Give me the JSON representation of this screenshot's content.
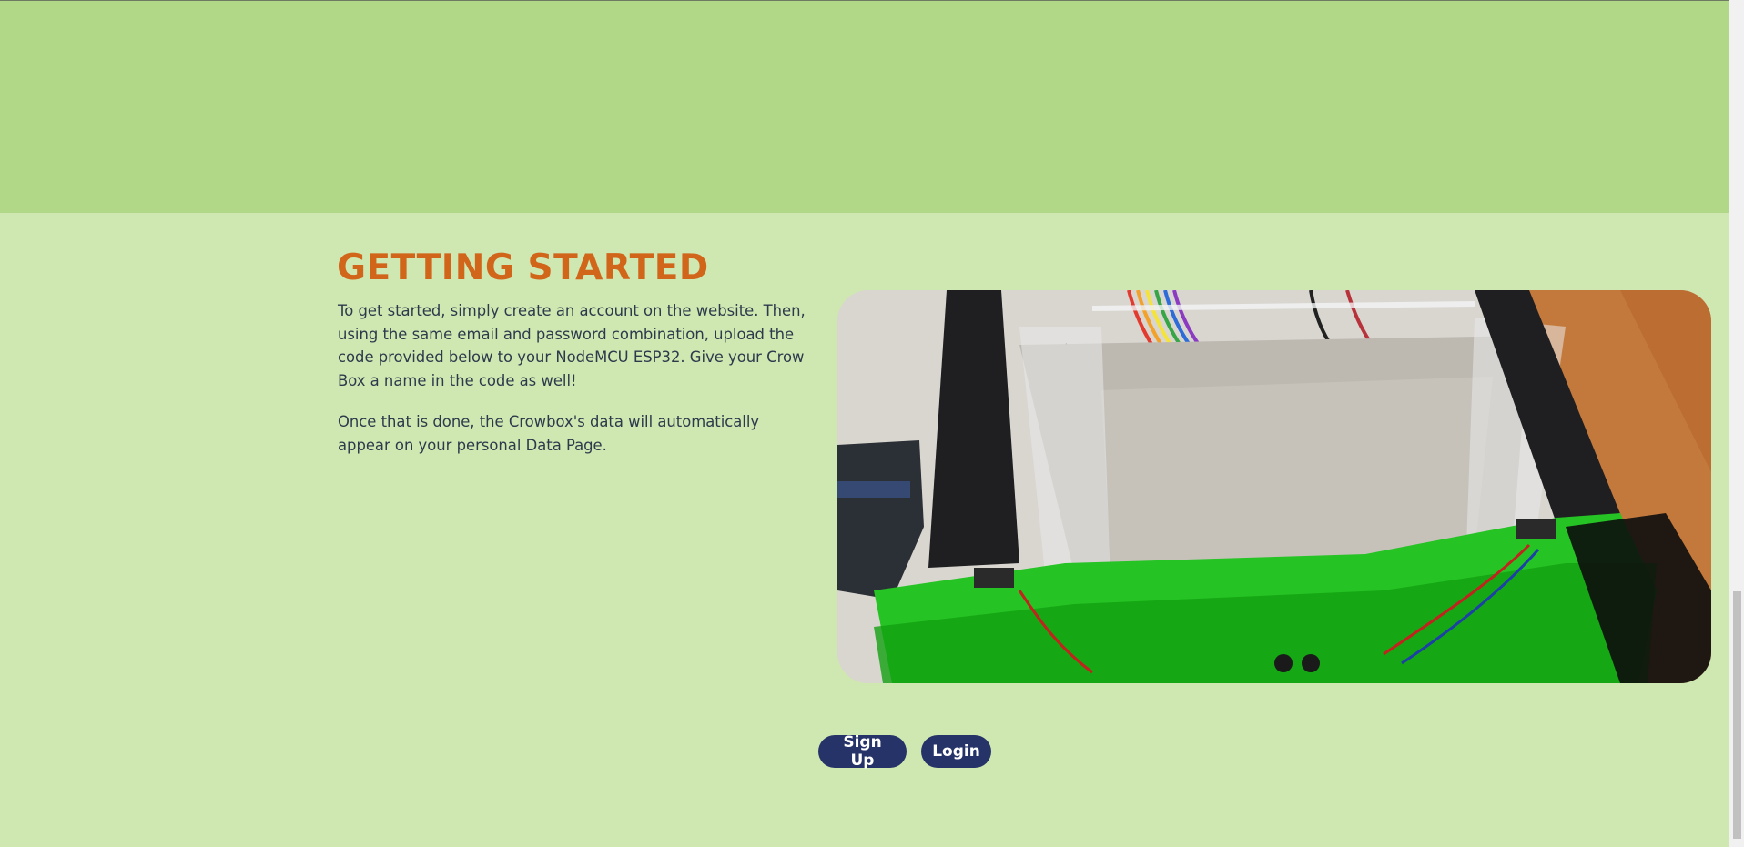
{
  "section": {
    "heading": "GETTING STARTED",
    "paragraphs": [
      "To get started, simply create an account on the website. Then, using the same email and password combination, upload the code provided below to your NodeMCU ESP32. Give your Crow Box a name in the code as well!",
      "Once that is done, the Crowbox's data will automatically appear on your personal Data Page."
    ]
  },
  "buttons": {
    "signup_label": "Sign Up",
    "login_label": "Login"
  },
  "colors": {
    "top_band": "#b0d886",
    "content_bg": "#cfe7b1",
    "heading": "#d1651a",
    "button_bg": "#263369"
  }
}
